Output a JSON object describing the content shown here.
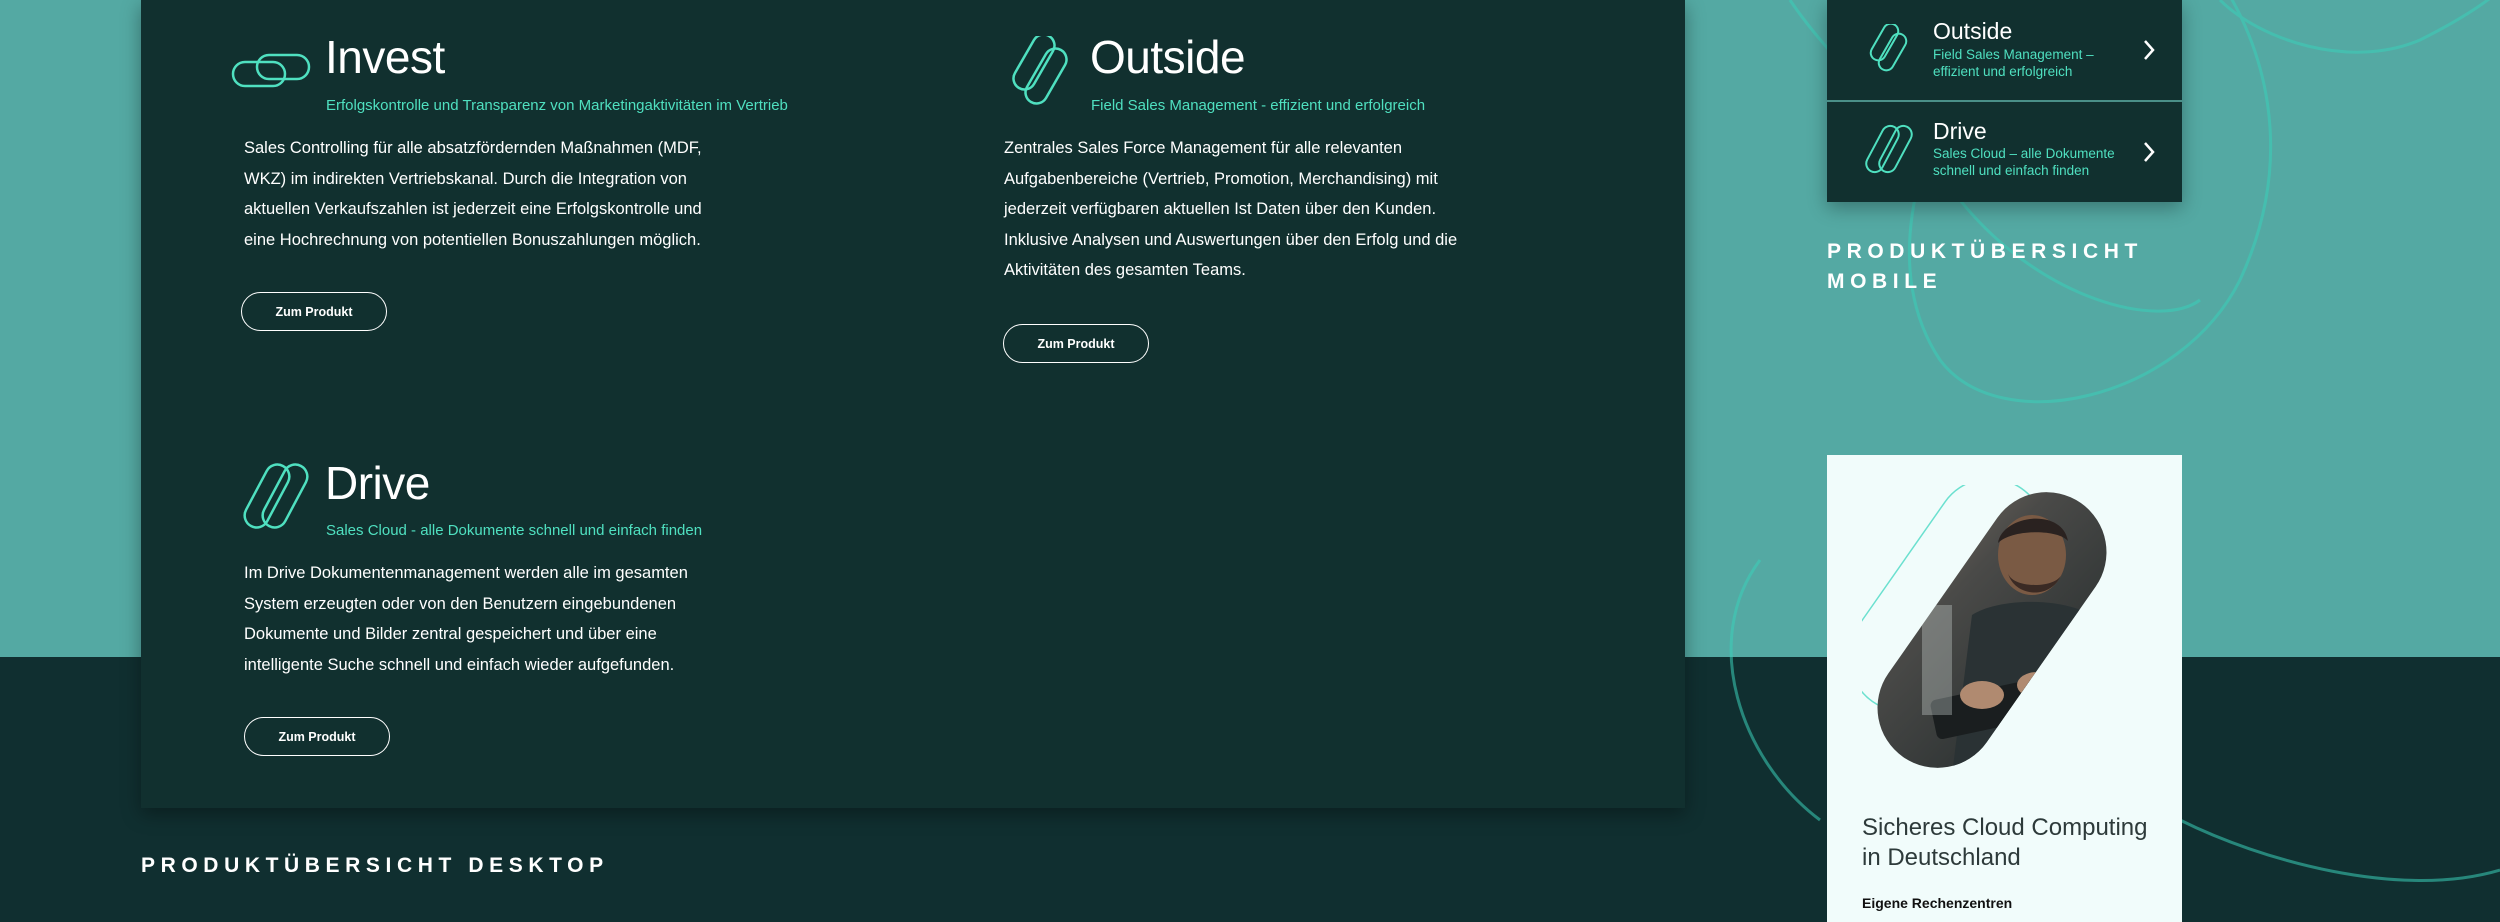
{
  "desktop": {
    "section_label": "PRODUKTÜBERSICHT DESKTOP",
    "products": [
      {
        "icon": "invest-icon",
        "title": "Invest",
        "subtitle": "Erfolgskontrolle und Transparenz von Marketingaktivitäten im Vertrieb",
        "desc_lines": [
          "Sales Controlling für alle absatzfördernden Maßnahmen (MDF,",
          "WKZ) im indirekten Vertriebskanal. Durch die Integration von",
          "aktuellen Verkaufszahlen ist jederzeit eine Erfolgskontrolle und",
          "eine Hochrechnung von potentiellen Bonuszahlungen möglich."
        ],
        "button": "Zum Produkt"
      },
      {
        "icon": "outside-icon",
        "title": "Outside",
        "subtitle": "Field Sales Management - effizient und erfolgreich",
        "desc_lines": [
          "Zentrales Sales Force Management für alle relevanten",
          "Aufgabenbereiche (Vertrieb, Promotion, Merchandising) mit",
          "jederzeit verfügbaren aktuellen Ist Daten über den Kunden.",
          "Inklusive Analysen und Auswertungen über den Erfolg und die",
          "Aktivitäten des gesamten Teams."
        ],
        "button": "Zum Produkt"
      },
      {
        "icon": "drive-icon",
        "title": "Drive",
        "subtitle": "Sales Cloud - alle Dokumente schnell und einfach finden",
        "desc_lines": [
          "Im Drive Dokumentenmanagement werden alle im gesamten",
          "System erzeugten oder von den Benutzern eingebundenen",
          "Dokumente und Bilder zentral gespeichert und über eine",
          "intelligente Suche schnell und einfach wieder aufgefunden."
        ],
        "button": "Zum Produkt"
      }
    ]
  },
  "mobile": {
    "section_label_line1": "PRODUKTÜBERSICHT",
    "section_label_line2": "MOBILE",
    "menu_items": [
      {
        "icon": "outside-icon",
        "title": "Outside",
        "sub_line1": "Field Sales Management –",
        "sub_line2": "effizient und erfolgreich"
      },
      {
        "icon": "drive-icon",
        "title": "Drive",
        "sub_line1": "Sales Cloud – alle Dokumente",
        "sub_line2": "schnell und einfach finden"
      }
    ]
  },
  "card": {
    "image": "man-using-tablet-photo",
    "title_line1": "Sicheres Cloud Computing",
    "title_line2": "in Deutschland",
    "sub": "Eigene Rechenzentren"
  },
  "colors": {
    "teal_bg": "#54a9a3",
    "dark_bg": "#102f30",
    "accent": "#4fe0c0",
    "card_bg": "#f1fcfb"
  }
}
